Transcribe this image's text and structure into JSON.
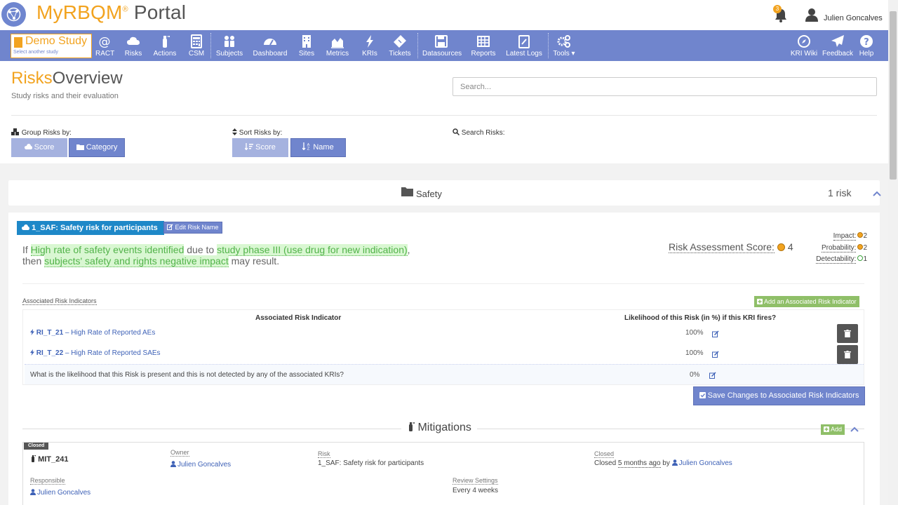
{
  "header": {
    "brand": "MyRBQM",
    "brand_reg": "®",
    "brand_suffix": " Portal",
    "notification_count": "3",
    "user_name": "Julien Goncalves"
  },
  "study": {
    "title": "Demo Study",
    "subtitle": "Select another study"
  },
  "nav": {
    "ract": "RACT",
    "risks": "Risks",
    "actions": "Actions",
    "csm": "CSM",
    "subjects": "Subjects",
    "dashboard": "Dashboard",
    "sites": "Sites",
    "metrics": "Metrics",
    "kris": "KRIs",
    "tickets": "Tickets",
    "datasources": "Datasources",
    "reports": "Reports",
    "latest_logs": "Latest Logs",
    "tools": "Tools ▾",
    "kri_wiki": "KRI Wiki",
    "feedback": "Feedback",
    "help": "Help"
  },
  "page": {
    "title_accent": "Risks",
    "title_rest": "Overview",
    "subtitle": "Study risks and their evaluation"
  },
  "controls": {
    "group_label": "Group Risks by:",
    "group_score": "Score",
    "group_category": "Category",
    "sort_label": "Sort Risks by:",
    "sort_score": "Score",
    "sort_name": "Name",
    "search_label": "Search Risks:",
    "search_placeholder": "Search..."
  },
  "group": {
    "name": "Safety",
    "count": "1 risk"
  },
  "risk": {
    "tag": "1_SAF: Safety risk for participants",
    "edit_label": "Edit Risk Name",
    "statement": {
      "if": "If ",
      "cause": "High rate of safety events identified",
      "due_to": " due to ",
      "source": "study phase III (use drug for new indication)",
      "comma": ",",
      "then": "then ",
      "impact": "subjects' safety and rights negative impact",
      "tail": " may result."
    },
    "score_label": "Risk Assessment Score:",
    "score_value": "4",
    "impact_label": "Impact:",
    "impact_value": "2",
    "probability_label": "Probability:",
    "probability_value": "2",
    "detectability_label": "Detectability:",
    "detectability_value": "1"
  },
  "ari": {
    "section_label": "Associated Risk Indicators",
    "add_label": "Add an Associated Risk Indicator",
    "col_indicator": "Associated Risk Indicator",
    "col_likelihood": "Likelihood of this Risk (in %) if this KRI fires?",
    "rows": [
      {
        "code": "RI_T_21",
        "name": " – High Rate of Reported AEs",
        "pct": "100%"
      },
      {
        "code": "RI_T_22",
        "name": " – High Rate of Reported SAEs",
        "pct": "100%"
      }
    ],
    "undetected_question": "What is the likelihood that this Risk is present and this is not detected by any of the associated KRIs?",
    "undetected_pct": "0%",
    "save_label": "Save Changes to Associated Risk Indicators"
  },
  "mitigations": {
    "title": "Mitigations",
    "add_label": "Add",
    "item": {
      "status": "Closed",
      "id": "MIT_241",
      "owner_label": "Owner",
      "owner": "Julien Goncalves",
      "risk_label": "Risk",
      "risk": "1_SAF: Safety risk for participants",
      "closed_label": "Closed",
      "closed_prefix": "Closed ",
      "closed_when": "5 months ago",
      "closed_by": " by ",
      "closed_user": "Julien Goncalves",
      "responsible_label": "Responsible",
      "responsible": "Julien Goncalves",
      "review_label": "Review Settings",
      "review": "Every 4 weeks"
    }
  }
}
